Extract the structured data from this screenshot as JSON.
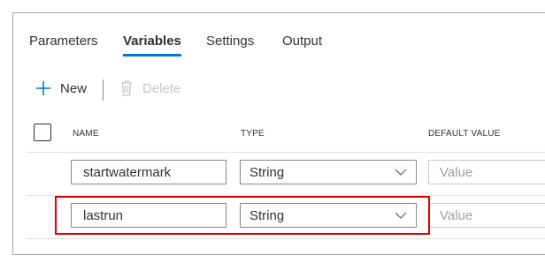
{
  "tabs": [
    {
      "label": "Parameters",
      "active": false
    },
    {
      "label": "Variables",
      "active": true
    },
    {
      "label": "Settings",
      "active": false
    },
    {
      "label": "Output",
      "active": false
    }
  ],
  "toolbar": {
    "new_label": "New",
    "new_icon": "plus-icon",
    "delete_label": "Delete",
    "delete_icon": "trash-icon",
    "delete_enabled": false
  },
  "table": {
    "columns": [
      "NAME",
      "TYPE",
      "DEFAULT VALUE"
    ],
    "rows": [
      {
        "name": "startwatermark",
        "type": "String",
        "default_placeholder": "Value",
        "highlighted": false
      },
      {
        "name": "lastrun",
        "type": "String",
        "default_placeholder": "Value",
        "highlighted": true
      }
    ]
  },
  "colors": {
    "accent": "#0078d4",
    "highlight": "#e00000",
    "disabled": "#c8c6c4"
  }
}
